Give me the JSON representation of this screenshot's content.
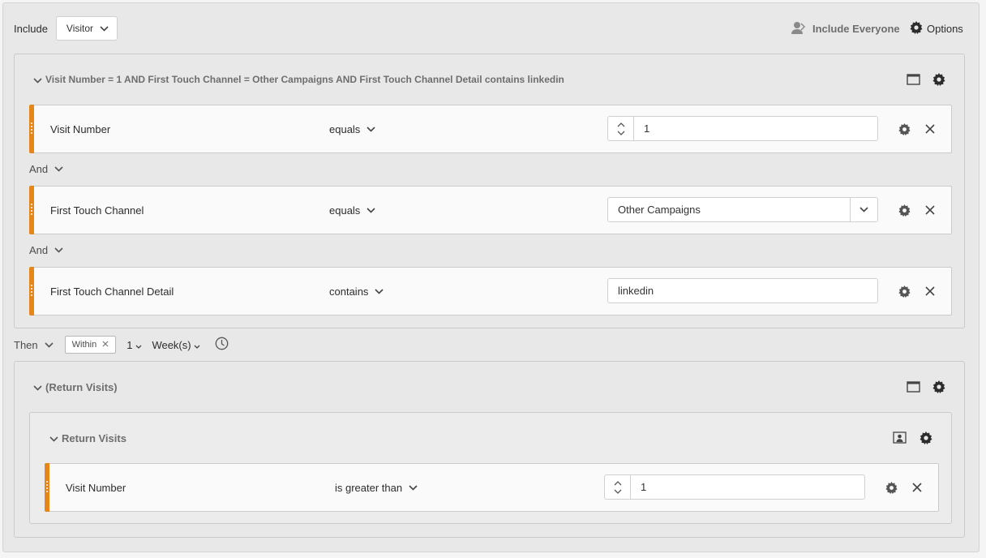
{
  "header": {
    "include_label": "Include",
    "context_value": "Visitor",
    "include_everyone": "Include Everyone",
    "options": "Options"
  },
  "container1": {
    "title": "Visit Number = 1 AND First Touch Channel = Other Campaigns AND First Touch Channel Detail contains linkedin",
    "rules": [
      {
        "dimension": "Visit Number",
        "operator": "equals",
        "value": "1"
      },
      {
        "dimension": "First Touch Channel",
        "operator": "equals",
        "value": "Other Campaigns"
      },
      {
        "dimension": "First Touch Channel Detail",
        "operator": "contains",
        "value": "linkedin"
      }
    ],
    "connectors": [
      "And",
      "And"
    ]
  },
  "sequence": {
    "then_label": "Then",
    "within_label": "Within",
    "count": "1",
    "unit": "Week(s)"
  },
  "container2": {
    "title": "(Return Visits)",
    "inner": {
      "title": "Return Visits",
      "rule": {
        "dimension": "Visit Number",
        "operator": "is greater than",
        "value": "1"
      }
    }
  },
  "colors": {
    "accent_handle": "#e68619",
    "panel_bg": "#e8e8e8",
    "rule_bg": "#fafafa"
  }
}
